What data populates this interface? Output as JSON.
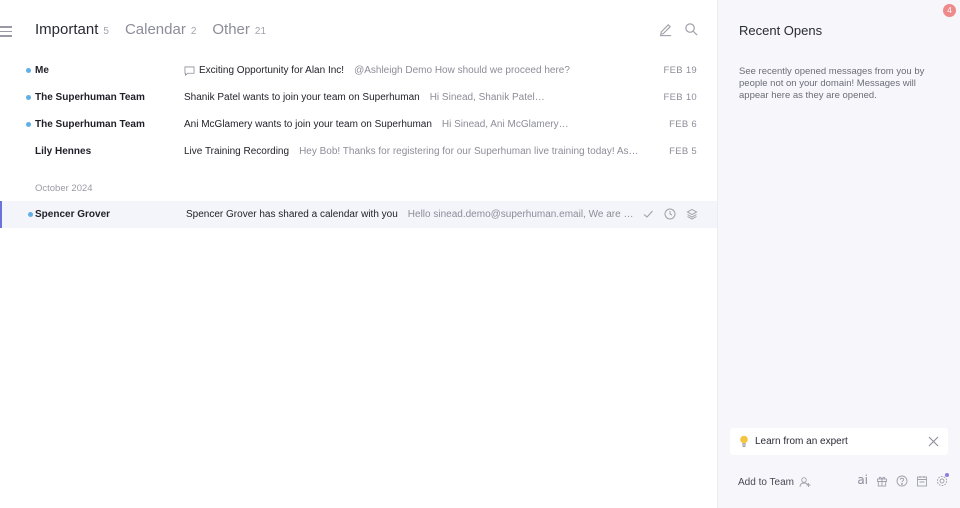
{
  "tabs": [
    {
      "label": "Important",
      "count": "5"
    },
    {
      "label": "Calendar",
      "count": "2"
    },
    {
      "label": "Other",
      "count": "21"
    }
  ],
  "threads": [
    {
      "sender": "Me",
      "subject": "Exciting Opportunity for Alan Inc!",
      "snippet": "@Ashleigh Demo How should we proceed here?",
      "date": "FEB 19",
      "unread": true
    },
    {
      "sender": "The Superhuman Team",
      "subject": "Shanik Patel wants to join your team on Superhuman",
      "snippet": "Hi Sinead, Shanik Patel…",
      "date": "FEB 10",
      "unread": true
    },
    {
      "sender": "The Superhuman Team",
      "subject": "Ani McGlamery wants to join your team on Superhuman",
      "snippet": "Hi Sinead, Ani McGlamery…",
      "date": "FEB 6",
      "unread": true
    },
    {
      "sender": "Lily Hennes",
      "subject": "Live Training Recording",
      "snippet": "Hey Bob! Thanks for registering for our Superhuman live training today! As promised, …",
      "date": "FEB 5",
      "unread": false
    }
  ],
  "section": {
    "label": "October 2024"
  },
  "selected_thread": {
    "sender": "Spencer Grover",
    "subject": "Spencer Grover has shared a calendar with you",
    "snippet": "Hello sinead.demo@superhuman.email, We are writing to le…"
  },
  "side": {
    "title": "Recent Opens",
    "description": "See recently opened messages from you by people not on your domain! Messages will appear here as they are opened.",
    "badge_count": "4",
    "learn_label": "Learn from an expert",
    "add_team_label": "Add to Team",
    "ai_label": "ai"
  },
  "icons": {
    "compose": "compose-icon",
    "search": "search-icon",
    "chat": "chat-bubble-icon",
    "done": "check-icon",
    "remind": "clock-icon",
    "stack": "layers-icon",
    "bulb": "lightbulb-icon",
    "close": "close-icon",
    "add_person": "add-person-icon",
    "gift": "gift-icon",
    "help": "help-icon",
    "calendar": "calendar-icon",
    "settings": "settings-icon"
  },
  "colors": {
    "unread_dot": "#5fb0e6",
    "selected_bar": "#6b73d9",
    "badge": "#ef8a8a"
  }
}
